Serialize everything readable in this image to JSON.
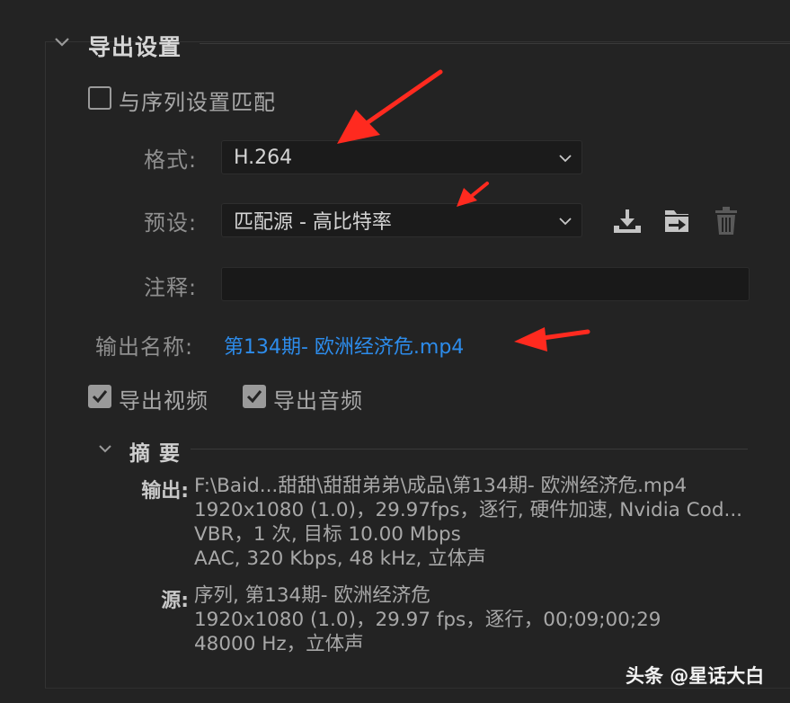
{
  "export_settings": {
    "title": "导出设置",
    "match_sequence_label": "与序列设置匹配",
    "format": {
      "label": "格式:",
      "value": "H.264"
    },
    "preset": {
      "label": "预设:",
      "value": "匹配源 - 高比特率"
    },
    "comments": {
      "label": "注释:",
      "value": ""
    },
    "output_name": {
      "label": "输出名称:",
      "value": "第134期- 欧洲经济危.mp4"
    },
    "export_video_label": "导出视频",
    "export_audio_label": "导出音频",
    "icons": [
      "save-preset-icon",
      "import-preset-icon",
      "delete-preset-icon"
    ],
    "summary": {
      "title": "摘 要",
      "output_key": "输出:",
      "output_lines": [
        "F:\\Baid...甜甜\\甜甜弟弟\\成品\\第134期- 欧洲经济危.mp4",
        "1920x1080 (1.0)，29.97fps，逐行, 硬件加速, Nvidia Cod...",
        "VBR，1 次, 目标 10.00 Mbps",
        "AAC, 320 Kbps, 48  kHz, 立体声"
      ],
      "source_key": "源:",
      "source_lines": [
        "序列, 第134期- 欧洲经济危",
        "1920x1080 (1.0)，29.97 fps，逐行，00;09;00;29",
        "48000 Hz，立体声"
      ]
    }
  },
  "watermark": "头条 @星话大白",
  "colors": {
    "background": "#232323",
    "link": "#2d8ceb",
    "annotation_arrow": "#ff2a1f"
  }
}
